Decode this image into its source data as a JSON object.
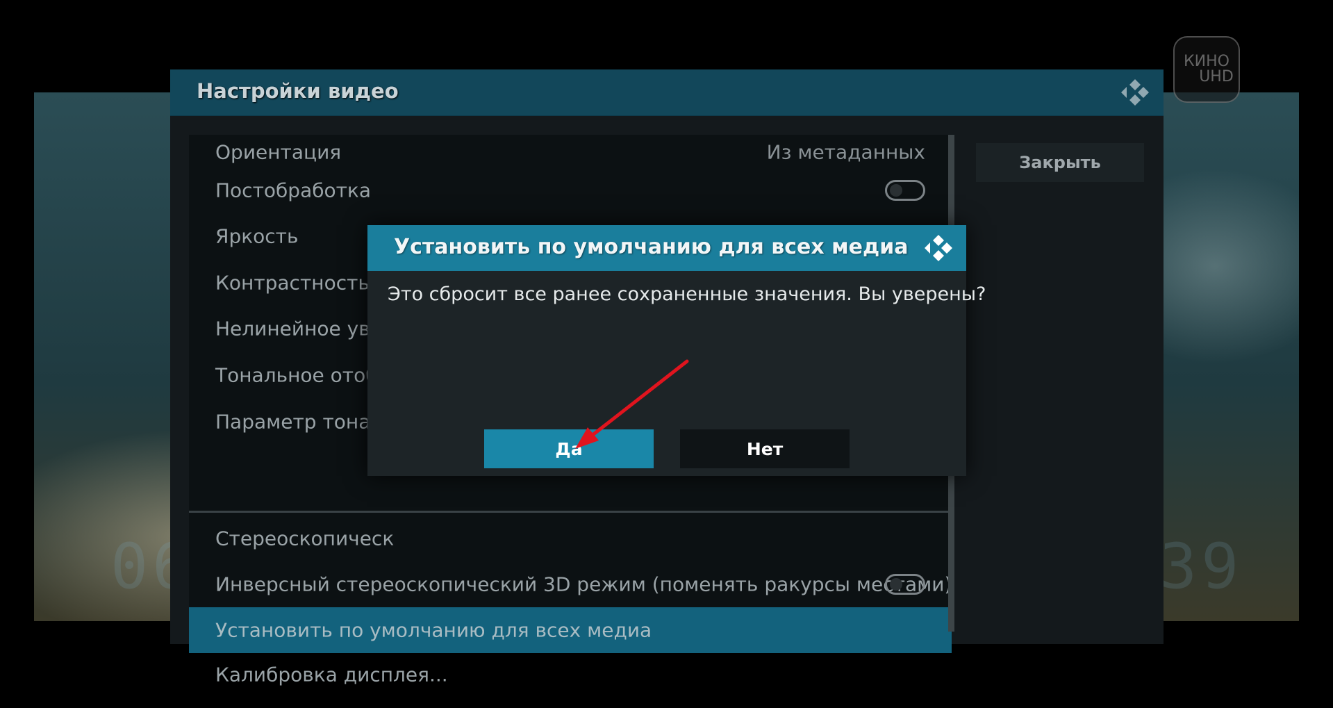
{
  "background": {
    "ghost_text_left": "06",
    "ghost_text_right": "39"
  },
  "channel_logo": {
    "line1": "КИНО",
    "line2": "UHD"
  },
  "panel": {
    "title": "Настройки видео",
    "close_label": "Закрыть",
    "items": [
      {
        "label": "Ориентация",
        "value": "Из метаданных"
      },
      {
        "label": "Постобработка",
        "toggle": false
      },
      {
        "label": "Яркость"
      },
      {
        "label": "Контрастность"
      },
      {
        "label": "Нелинейное увел"
      },
      {
        "label": "Тональное отобр"
      },
      {
        "label": "Параметр тональ"
      },
      {
        "label": "Стереоскопическ"
      },
      {
        "label": "Инверсный стереоскопический 3D режим (поменять ракурсы местами)",
        "toggle": false
      },
      {
        "label": "Установить по умолчанию для всех медиа",
        "focused": true
      },
      {
        "label": "Калибровка дисплея..."
      }
    ]
  },
  "dialog": {
    "title": "Установить по умолчанию для всех медиа",
    "message": "Это сбросит все ранее сохраненные значения. Вы уверены?",
    "yes_label": "Да",
    "no_label": "Нет"
  },
  "colors": {
    "header_bg": "#12475a",
    "dialog_header_bg": "#1a7e9c",
    "focused_item_bg": "#13627d",
    "yes_button_bg": "#1a87a8",
    "annotation_arrow": "#e0141e"
  }
}
